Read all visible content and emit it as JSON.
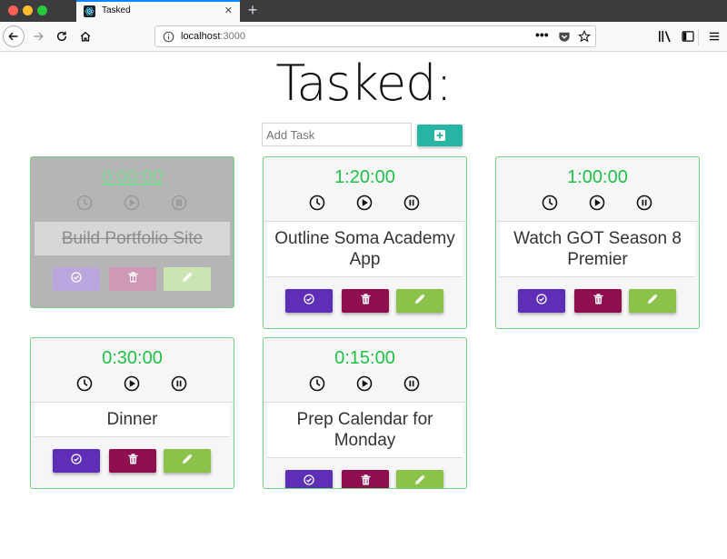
{
  "browser": {
    "tab_title": "Tasked",
    "url_host": "localhost",
    "url_port": ":3000",
    "new_tab_label": "+",
    "tab_close_label": "✕",
    "url_more_label": "•••"
  },
  "app": {
    "title": "Tasked:",
    "add_placeholder": "Add Task"
  },
  "colors": {
    "timer_green": "#1fc247",
    "card_border": "#74d37f",
    "add_button": "#26b5a2",
    "complete_button": "#5e2fb6",
    "delete_button": "#8f0e50",
    "edit_button": "#8bc34a"
  },
  "tasks": [
    {
      "time": "0:00:00",
      "name": "Build Portfolio Site",
      "completed": true
    },
    {
      "time": "1:20:00",
      "name": "Outline Soma Academy App",
      "completed": false
    },
    {
      "time": "1:00:00",
      "name": "Watch GOT Season 8 Premier",
      "completed": false
    },
    {
      "time": "0:30:00",
      "name": "Dinner",
      "completed": false
    },
    {
      "time": "0:15:00",
      "name": "Prep Calendar for Monday",
      "completed": false
    }
  ],
  "icons": {
    "clock": "clock-icon",
    "play": "play-icon",
    "pause": "pause-icon",
    "complete": "check-circle-icon",
    "delete": "trash-icon",
    "edit": "pencil-icon",
    "add": "plus-square-icon"
  }
}
